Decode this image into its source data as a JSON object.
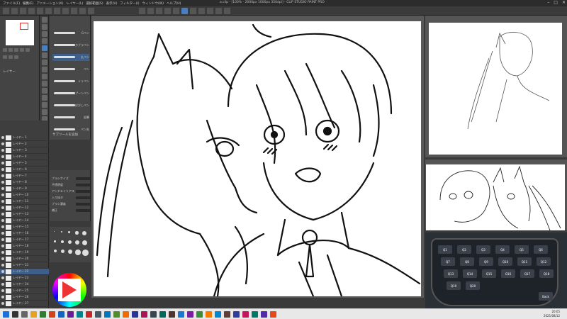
{
  "window": {
    "title": "a.clip - [100% - 2000px 1000px 350dpi] - CLIP STUDIO PAINT PRO",
    "menu": [
      "ファイル(F)",
      "編集(E)",
      "アニメーション(A)",
      "レイヤー(L)",
      "選択範囲(S)",
      "表示(V)",
      "フィルター(I)",
      "ウィンドウ(W)",
      "ヘルプ(H)"
    ]
  },
  "brushes": [
    {
      "label": "Gペン"
    },
    {
      "label": "カブラペン"
    },
    {
      "label": "丸ペン"
    },
    {
      "label": "ペン"
    },
    {
      "label": "ミリペン"
    },
    {
      "label": "スプーンペン"
    },
    {
      "label": "ぼかしペン"
    },
    {
      "label": "鉛筆"
    },
    {
      "label": "ペン先"
    }
  ],
  "brush_footer": "サブツールを追加",
  "nav": {
    "label": "レイヤー"
  },
  "layers": [
    {
      "name": "レイヤー 1",
      "selected": false
    },
    {
      "name": "レイヤー 2",
      "selected": false
    },
    {
      "name": "レイヤー 3",
      "selected": false
    },
    {
      "name": "レイヤー 4",
      "selected": false
    },
    {
      "name": "レイヤー 5",
      "selected": false
    },
    {
      "name": "レイヤー 6",
      "selected": false
    },
    {
      "name": "レイヤー 7",
      "selected": false
    },
    {
      "name": "レイヤー 8",
      "selected": false
    },
    {
      "name": "レイヤー 9",
      "selected": false
    },
    {
      "name": "レイヤー 10",
      "selected": false
    },
    {
      "name": "レイヤー 11",
      "selected": false
    },
    {
      "name": "レイヤー 12",
      "selected": false
    },
    {
      "name": "レイヤー 13",
      "selected": false
    },
    {
      "name": "レイヤー 14",
      "selected": false
    },
    {
      "name": "レイヤー 15",
      "selected": false
    },
    {
      "name": "レイヤー 16",
      "selected": false
    },
    {
      "name": "レイヤー 17",
      "selected": false
    },
    {
      "name": "レイヤー 18",
      "selected": false
    },
    {
      "name": "レイヤー 19",
      "selected": false
    },
    {
      "name": "レイヤー 20",
      "selected": false
    },
    {
      "name": "レイヤー 21",
      "selected": false
    },
    {
      "name": "レイヤー 22",
      "selected": true
    },
    {
      "name": "レイヤー 23",
      "selected": false
    },
    {
      "name": "レイヤー 24",
      "selected": false
    },
    {
      "name": "レイヤー 25",
      "selected": false
    },
    {
      "name": "レイヤー 26",
      "selected": false
    },
    {
      "name": "レイヤー 27",
      "selected": false
    }
  ],
  "tool_properties": [
    {
      "label": "ブラシサイズ"
    },
    {
      "label": "不透明度"
    },
    {
      "label": "アンチエイリアス"
    },
    {
      "label": "入り抜き"
    },
    {
      "label": "ブラシ濃度"
    },
    {
      "label": "補正"
    }
  ],
  "keypad": {
    "keys": [
      "Q1",
      "Q2",
      "Q3",
      "Q4",
      "Q5",
      "Q6",
      "Q7",
      "Q8",
      "Q9",
      "Q10",
      "Q11",
      "Q12",
      "Q13",
      "Q14",
      "Q15",
      "Q16",
      "Q17",
      "Q18",
      "Q19",
      "Q20"
    ],
    "back_label": "Back"
  },
  "taskbar": {
    "time": "20:05",
    "date": "2021/08/12"
  }
}
